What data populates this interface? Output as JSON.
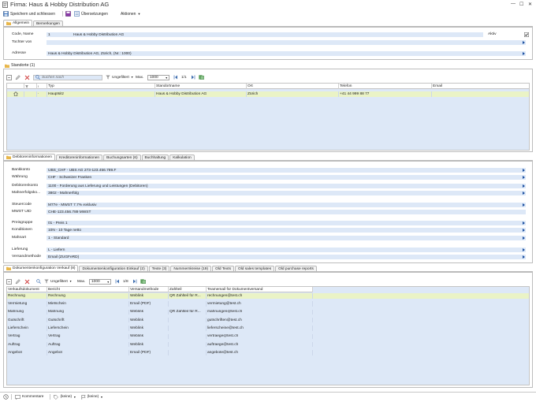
{
  "window": {
    "title": "Firma: Haus & Hobby Distribution AG"
  },
  "toolbar": {
    "save_close": "Speichern und schliessen",
    "translations": "Übersetzungen",
    "actions": "Aktionen"
  },
  "top_tabs": [
    "Allgemein",
    "Bemerkungen"
  ],
  "general": {
    "code_label": "Code, Name",
    "code": "1",
    "name": "Haus & Hobby Distribution AG",
    "active_label": "Aktiv",
    "active": true,
    "subsidiary_label": "Tochter von",
    "subsidiary": "",
    "address_label": "Adresse",
    "address": "Haus & Hobby Distribution AG, Zürich, (Nr.: 1000)"
  },
  "locations": {
    "title": "Standorte (1)",
    "search_placeholder": "Suchen nach",
    "filter": "Ungefiltert",
    "max_label": "Max.",
    "max_value": "1000",
    "pager": "1/1",
    "columns": [
      "Typ",
      "Standortname",
      "Ort",
      "Telefon",
      "Email"
    ],
    "rows": [
      {
        "dot": "·",
        "type": "Hauptsitz",
        "name": "Haus & Hobby Distribution AG",
        "city": "Zürich",
        "phone": "+41 44 999 88 77",
        "email": ""
      }
    ]
  },
  "mid_tabs": [
    "Debitoreninformationen",
    "Kreditoreninformationen",
    "Buchungsarten (6)",
    "Buchhaltung",
    "Kalkulation"
  ],
  "debtor": {
    "bank_label": "Bankkonto",
    "bank": "UBS_CHF  -  UBS AG 273-123.456.789.F",
    "currency_label": "Währung",
    "currency": "CHF  -  Schweizer Franken",
    "debtor_account_label": "Debitorenkonto",
    "debtor_account": "1100  -  Forderung aus Lieferung und Leistungen (Debitoren)",
    "dunning_label": "Mahnerfolgsko...",
    "dunning": "3802  -  Mahnerfolg",
    "tax_label": "Steuercode",
    "tax": "M77e  -  MWST 7.7% exklusiv",
    "vat_label": "MWST UID",
    "vat": "CHE-123.456.789 MWST",
    "pricegroup_label": "Preisgruppe",
    "pricegroup": "01  -  Preis 1",
    "conditions_label": "Konditionen",
    "conditions": "10N  -  10 Tage netto",
    "dunningtype_label": "Mahnart",
    "dunningtype": "1  -  Standard",
    "delivery_label": "Lieferung",
    "delivery": "L  -  Liefern",
    "shipping_label": "Versandmethode",
    "shipping": "Email (ZUGFeRD)"
  },
  "bottom_tabs": [
    "Dokumentenkonfiguration Verkauf (8)",
    "Dokumentenkonfiguration Einkauf (2)",
    "Texte (3)",
    "Nummernkreise (19)",
    "Old Texts",
    "Old sales templates",
    "Old purchase reports"
  ],
  "docs": {
    "filter": "Ungefiltert",
    "max_label": "Max.",
    "max_value": "1000",
    "pager": "1/8",
    "columns": [
      "Verkaufsdokument",
      "Bericht",
      "Versandmethode",
      "Zahlteil",
      "Teamemail für Dokumentversand"
    ],
    "rows": [
      {
        "doc": "Rechnung",
        "report": "Rechnung",
        "method": "Weblink",
        "pay": "QR Zahlteil für R...",
        "email": "rechnungen@test.ch"
      },
      {
        "doc": "Vermietung",
        "report": "Mietschein",
        "method": "Email (PDF)",
        "pay": "",
        "email": "vermietung@test.ch"
      },
      {
        "doc": "Mahnung",
        "report": "Mahnung",
        "method": "Weblink",
        "pay": "QR Zahlteil für R...",
        "email": "mahnungen@test.ch"
      },
      {
        "doc": "Gutschrift",
        "report": "Gutschrift",
        "method": "Weblink",
        "pay": "",
        "email": "gutschriften@test.ch"
      },
      {
        "doc": "Lieferschein",
        "report": "Lieferschein",
        "method": "Weblink",
        "pay": "",
        "email": "lieferscheine@test.ch"
      },
      {
        "doc": "Vertrag",
        "report": "Vertrag",
        "method": "Weblink",
        "pay": "",
        "email": "vertraege@test.ch"
      },
      {
        "doc": "Auftrag",
        "report": "Auftrag",
        "method": "Weblink",
        "pay": "",
        "email": "auftraege@test.ch"
      },
      {
        "doc": "Angebot",
        "report": "Angebot",
        "method": "Email (PDF)",
        "pay": "",
        "email": "angebote@test.ch"
      }
    ]
  },
  "statusbar": {
    "comments": "Kommentare",
    "none1": "(keine)",
    "none2": "(keine)"
  },
  "colors": {
    "field_bg": "#dde8f7",
    "selected_row": "#eaf3c6",
    "accent": "#1b4fa0",
    "folder": "#e8b64a"
  }
}
